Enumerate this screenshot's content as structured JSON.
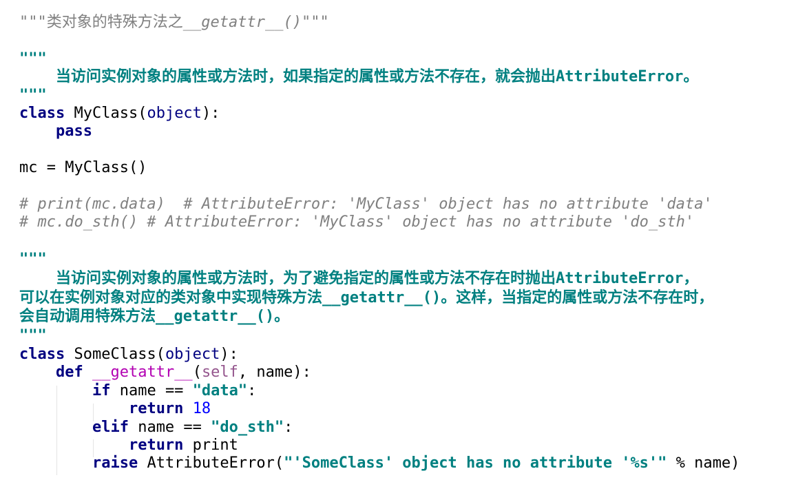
{
  "code_lines": [
    [
      [
        "doc1",
        "\"\"\""
      ],
      [
        "doc1c",
        "类对象的特殊方法之"
      ],
      [
        "doc1",
        "__getattr__()\"\"\""
      ]
    ],
    [],
    [
      [
        "doc",
        "\"\"\""
      ]
    ],
    [
      [
        "doc",
        "    当访问实例对象的属性或方法时，如果指定的属性或方法不存在，就会抛出AttributeError。"
      ]
    ],
    [
      [
        "doc",
        "\"\"\""
      ]
    ],
    [
      [
        "kw",
        "class"
      ],
      [
        "",
        "  MyClass("
      ],
      [
        "bi",
        "object"
      ],
      [
        "",
        "):"
      ]
    ],
    [
      [
        "",
        "    "
      ],
      [
        "kw",
        "pass"
      ]
    ],
    [],
    [
      [
        "",
        "mc = MyClass()"
      ]
    ],
    [],
    [
      [
        "cm",
        "# print(mc.data)  # AttributeError: 'MyClass' object has no attribute 'data'"
      ]
    ],
    [
      [
        "cm",
        "# mc.do_sth() # AttributeError: 'MyClass' object has no attribute 'do_sth'"
      ]
    ],
    [],
    [
      [
        "doc",
        "\"\"\""
      ]
    ],
    [
      [
        "doc",
        "    当访问实例对象的属性或方法时，为了避免指定的属性或方法不存在时抛出AttributeError，"
      ]
    ],
    [
      [
        "doc",
        "可以在实例对象对应的类对象中实现特殊方法__getattr__()。这样，当指定的属性或方法不存在时，"
      ]
    ],
    [
      [
        "doc",
        "会自动调用特殊方法__getattr__()。"
      ]
    ],
    [
      [
        "doc",
        "\"\"\""
      ]
    ],
    [
      [
        "kw",
        "class"
      ],
      [
        "",
        " SomeClass("
      ],
      [
        "bi",
        "object"
      ],
      [
        "",
        "):"
      ]
    ],
    [
      [
        "",
        "    "
      ],
      [
        "kw",
        "def"
      ],
      [
        "",
        " "
      ],
      [
        "magic",
        "__getattr__"
      ],
      [
        "",
        "("
      ],
      [
        "self",
        "self"
      ],
      [
        "",
        ", name):"
      ]
    ],
    [
      [
        "",
        "        "
      ],
      [
        "kw",
        "if"
      ],
      [
        "",
        " name == "
      ],
      [
        "str",
        "\"data\""
      ],
      [
        "",
        ":"
      ]
    ],
    [
      [
        "",
        "            "
      ],
      [
        "kw",
        "return"
      ],
      [
        "",
        " "
      ],
      [
        "num",
        "18"
      ]
    ],
    [
      [
        "",
        "        "
      ],
      [
        "kw",
        "elif"
      ],
      [
        "",
        " name == "
      ],
      [
        "str",
        "\"do_sth\""
      ],
      [
        "",
        ":"
      ]
    ],
    [
      [
        "",
        "            "
      ],
      [
        "kw",
        "return"
      ],
      [
        "",
        " print"
      ]
    ],
    [
      [
        "",
        "        "
      ],
      [
        "kw",
        "raise"
      ],
      [
        "",
        " AttributeError("
      ],
      [
        "str",
        "\"'SomeClass' object has no attribute '%s'\""
      ],
      [
        "",
        " % name)"
      ]
    ]
  ]
}
